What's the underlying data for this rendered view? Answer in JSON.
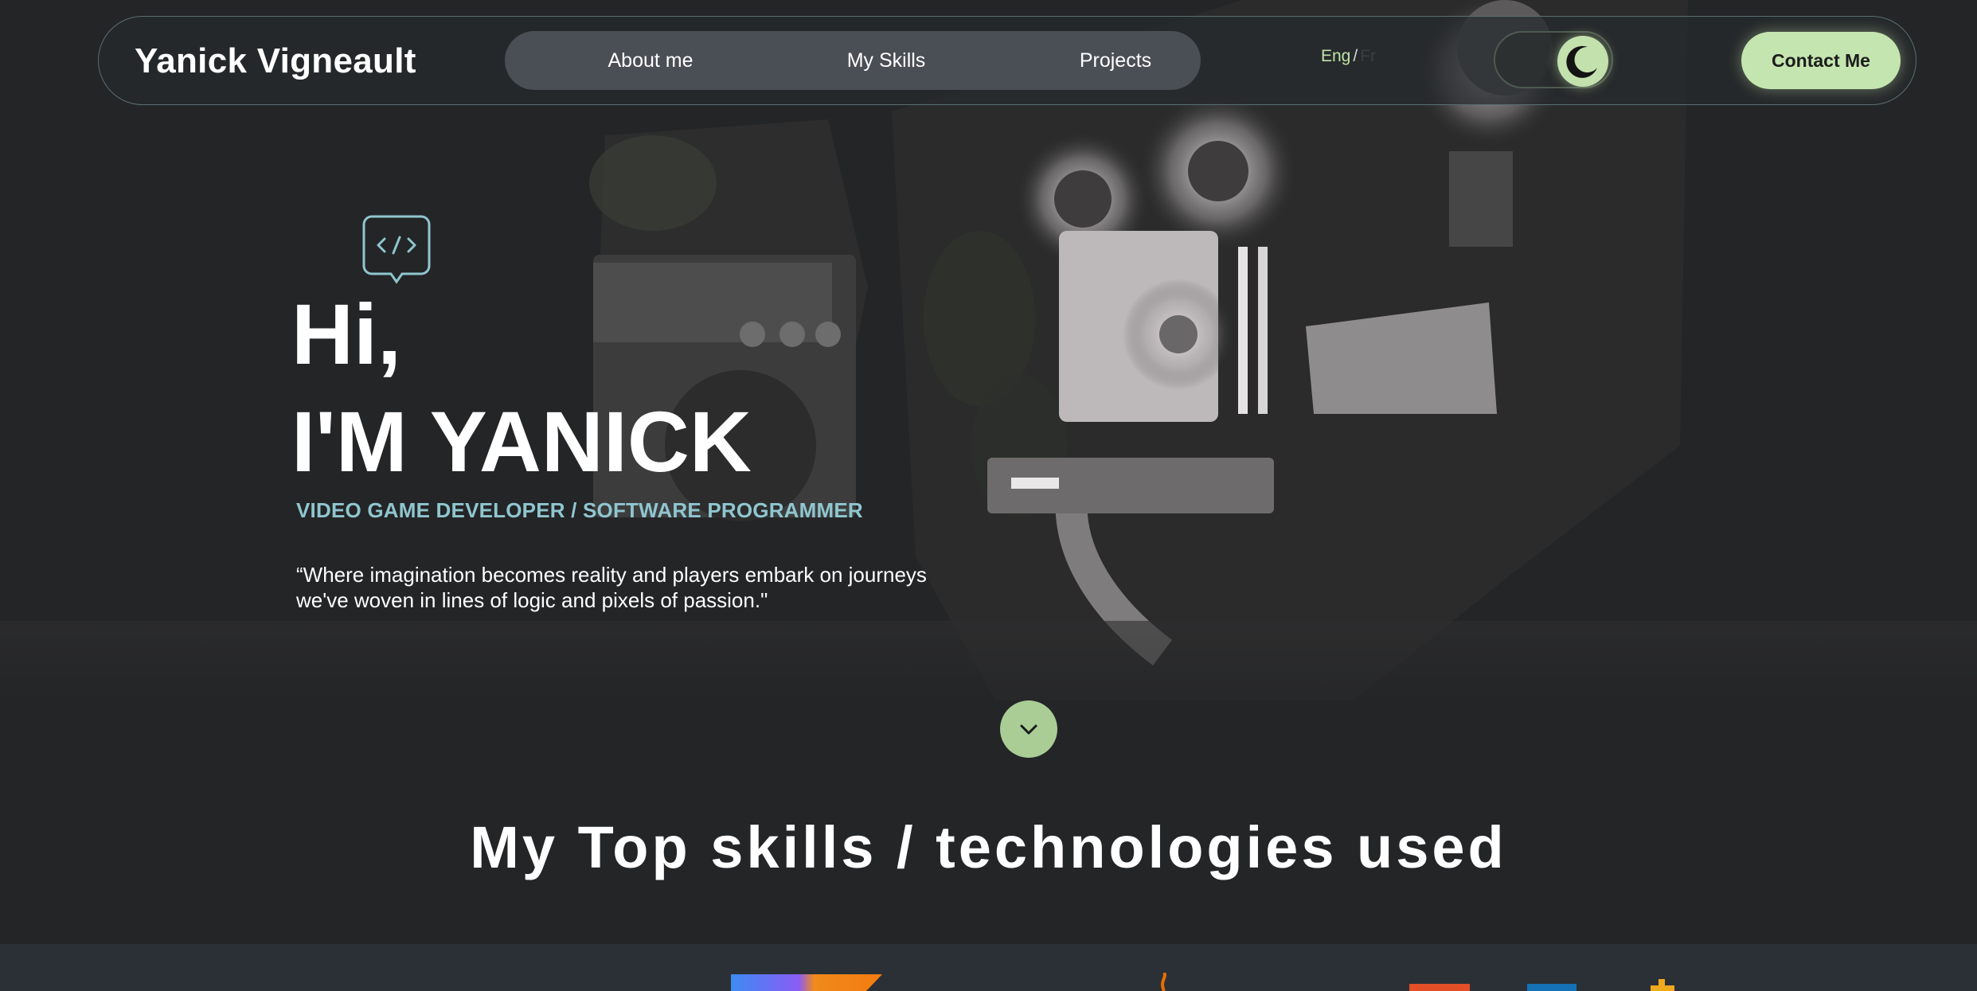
{
  "brand": "Yanick Vigneault",
  "nav": {
    "items": [
      "About me",
      "My Skills",
      "Projects"
    ]
  },
  "language": {
    "eng": "Eng",
    "separator": "/",
    "fr": "Fr"
  },
  "theme_toggle": {
    "mode": "dark",
    "icon": "moon-icon"
  },
  "contact_label": "Contact Me",
  "hero": {
    "icon": "code-bubble-icon",
    "greeting": "Hi,",
    "name": "I'M YANICK",
    "role": "VIDEO GAME DEVELOPER / SOFTWARE PROGRAMMER",
    "quote_line1": "“Where imagination becomes reality and players embark on journeys",
    "quote_line2": "we've woven in lines of logic and pixels of passion.\"",
    "scroll_icon": "chevron-down-icon"
  },
  "skills": {
    "title": "My Top skills / technologies used",
    "logos": [
      "kotlin-logo",
      "java-logo",
      "html-logo",
      "css-logo",
      "js-logo"
    ]
  },
  "colors": {
    "background": "#242527",
    "accent_green": "#c5e5b0",
    "accent_teal": "#8fc6cf",
    "nav_pill": "#4a4e55"
  }
}
